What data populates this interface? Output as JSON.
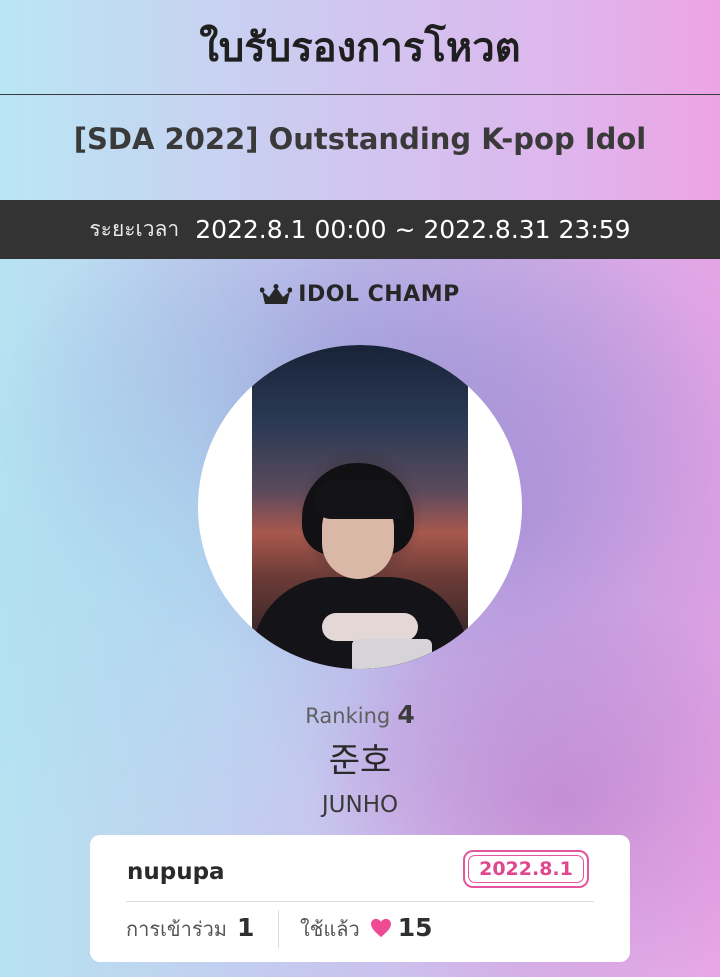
{
  "header": {
    "title": "ใบรับรองการโหวต",
    "event_name": "[SDA 2022] Outstanding K-pop Idol"
  },
  "period": {
    "label": "ระยะเวลา",
    "range": "2022.8.1 00:00 ~ 2022.8.31 23:59"
  },
  "brand": {
    "name": "IDOL CHAMP",
    "icon": "crown-icon"
  },
  "idol": {
    "ranking_label": "Ranking",
    "ranking_value": "4",
    "name": "준호",
    "romanized": "JUNHO"
  },
  "card": {
    "username": "nupupa",
    "date": "2022.8.1",
    "participation_label": "การเข้าร่วม",
    "participation_value": "1",
    "used_label": "ใช้แล้ว",
    "used_icon": "heart-icon",
    "used_value": "15"
  },
  "colors": {
    "accent_pink": "#e4559e",
    "period_bar": "#333333"
  }
}
